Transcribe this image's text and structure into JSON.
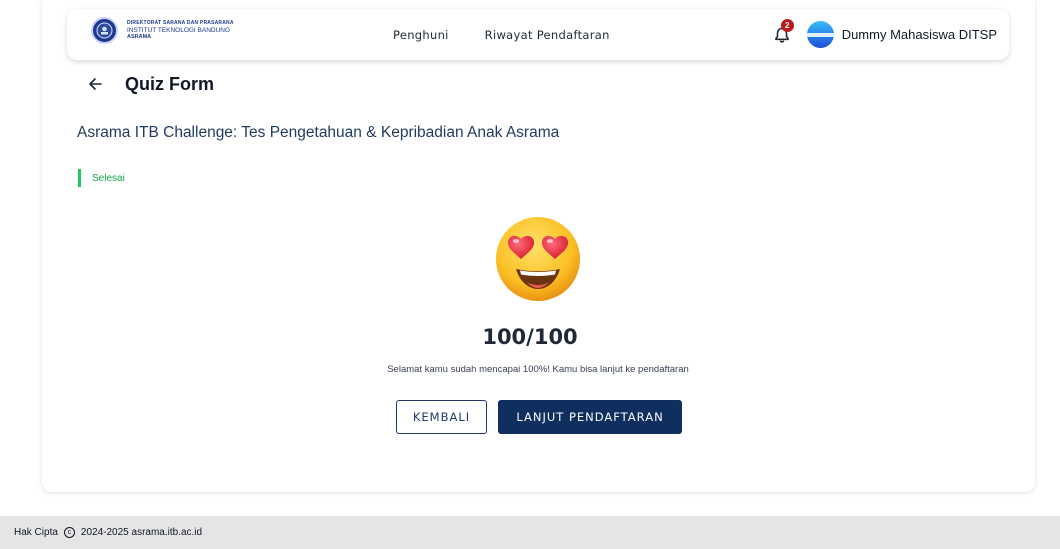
{
  "brand": {
    "line1": "DIREKTORAT SARANA DAN PRASARANA",
    "line2": "INSTITUT TEKNOLOGI BANDUNG",
    "line3": "ASRAMA"
  },
  "nav": {
    "links": [
      "Penghuni",
      "Riwayat Pendaftaran"
    ],
    "notification_count": "2",
    "user_name": "Dummy Mahasiswa DITSP"
  },
  "header": {
    "title": "Quiz Form"
  },
  "quiz": {
    "title": "Asrama ITB Challenge: Tes Pengetahuan & Kepribadian Anak Asrama",
    "status": "Selesai",
    "score": "100/100",
    "message": "Selamat kamu sudah mencapai 100%! Kamu bisa lanjut ke pendaftaran"
  },
  "buttons": {
    "back": "KEMBALI",
    "next": "LANJUT PENDAFTARAN"
  },
  "footer": {
    "prefix": "Hak Cipta",
    "text": "2024-2025 asrama.itb.ac.id"
  },
  "colors": {
    "primary": "#0f2f5e",
    "success": "#22c55e",
    "badge": "#b91c1c"
  }
}
